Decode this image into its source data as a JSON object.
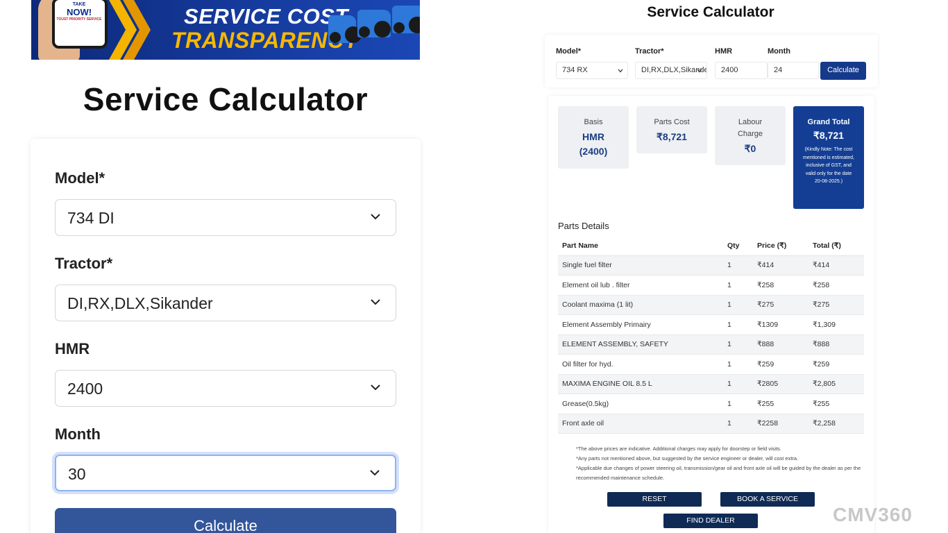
{
  "banner": {
    "title_line1": "SERVICE COST",
    "title_line2": "TRANSPARENCY",
    "phone_line1": "TAKE",
    "phone_line2": "NOW!",
    "phone_small": "TOUST PRIORITY SERVICE",
    "colors": {
      "background": "#153a9c",
      "accent": "#f6b800"
    }
  },
  "left_form": {
    "title": "Service Calculator",
    "model_label": "Model*",
    "model_value": "734 DI",
    "tractor_label": "Tractor*",
    "tractor_value": "DI,RX,DLX,Sikander",
    "hmr_label": "HMR",
    "hmr_value": "2400",
    "month_label": "Month",
    "month_value": "30",
    "calculate_label": "Calculate"
  },
  "right_form": {
    "title": "Service Calculator",
    "model_label": "Model*",
    "model_value": "734 RX",
    "tractor_label": "Tractor*",
    "tractor_value": "DI,RX,DLX,Sikander",
    "hmr_label": "HMR",
    "hmr_value": "2400",
    "month_label": "Month",
    "month_value": "24",
    "calculate_label": "Calculate"
  },
  "summary": {
    "basis_label": "Basis",
    "basis_value": "HMR (2400)",
    "parts_label": "Parts Cost",
    "parts_value": "₹8,721",
    "labour_label": "Labour Charge",
    "labour_value": "₹0",
    "grand_label": "Grand Total",
    "grand_value": "₹8,721",
    "grand_note": "(Kindly Note: The cost mentioned is estimated, inclusive of GST, and valid only for the date 20-08-2025.)"
  },
  "parts": {
    "heading": "Parts Details",
    "columns": [
      "Part Name",
      "Qty",
      "Price (₹)",
      "Total (₹)"
    ],
    "rows": [
      [
        "Single fuel filter",
        "1",
        "₹414",
        "₹414"
      ],
      [
        "Element oil lub . filter",
        "1",
        "₹258",
        "₹258"
      ],
      [
        "Coolant maxima (1 lit)",
        "1",
        "₹275",
        "₹275"
      ],
      [
        "Element Assembly Primairy",
        "1",
        "₹1309",
        "₹1,309"
      ],
      [
        "ELEMENT ASSEMBLY, SAFETY",
        "1",
        "₹888",
        "₹888"
      ],
      [
        "Oil filter for hyd.",
        "1",
        "₹259",
        "₹259"
      ],
      [
        "MAXIMA ENGINE OIL 8.5 L",
        "1",
        "₹2805",
        "₹2,805"
      ],
      [
        "Grease(0.5kg)",
        "1",
        "₹255",
        "₹255"
      ],
      [
        "Front axle oil",
        "1",
        "₹2258",
        "₹2,258"
      ]
    ]
  },
  "notes": [
    "*The above prices are indicative. Additional charges may apply for doorstep or field visits.",
    "*Any parts not mentioned above, but suggested by the service engineer or dealer, will cost extra.",
    "*Applicable due changes of power steering oil, transmission/gear oil and front axle oil will be guided by the dealer as per the recommended maintenance schedule."
  ],
  "actions": {
    "reset": "RESET",
    "book": "BOOK A SERVICE",
    "dealer": "FIND DEALER"
  },
  "watermark": "CMV360",
  "icons": {
    "select_arrow": "chevron-down-icon"
  },
  "colors": {
    "primary": "#143e94",
    "button_dark": "#0f2a55",
    "left_button": "#33559a"
  }
}
